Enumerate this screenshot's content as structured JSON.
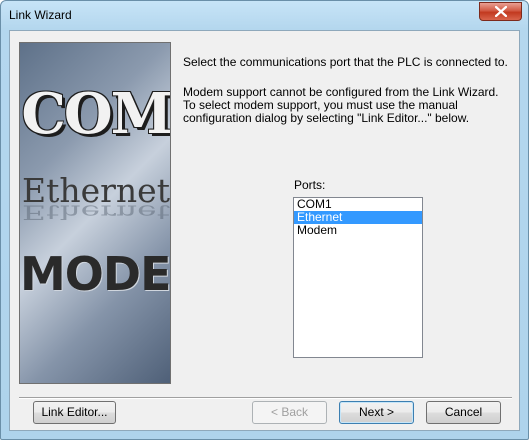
{
  "window": {
    "title": "Link Wizard"
  },
  "artwork": {
    "words": [
      "COM",
      "Ethernet",
      "MODEM"
    ]
  },
  "content": {
    "instruction": "Select the communications port that the PLC is connected to.",
    "modem_note": "Modem support cannot be configured from the Link Wizard.\nTo select modem support, you must use the manual\nconfiguration dialog by selecting \"Link Editor...\" below.",
    "ports_label": "Ports:",
    "ports": [
      {
        "label": "COM1",
        "selected": false
      },
      {
        "label": "Ethernet",
        "selected": true
      },
      {
        "label": "Modem",
        "selected": false
      }
    ]
  },
  "buttons": {
    "link_editor": "Link Editor...",
    "back": "< Back",
    "next": "Next >",
    "cancel": "Cancel"
  },
  "colors": {
    "selection": "#3399ff",
    "close_button": "#c2391f"
  }
}
